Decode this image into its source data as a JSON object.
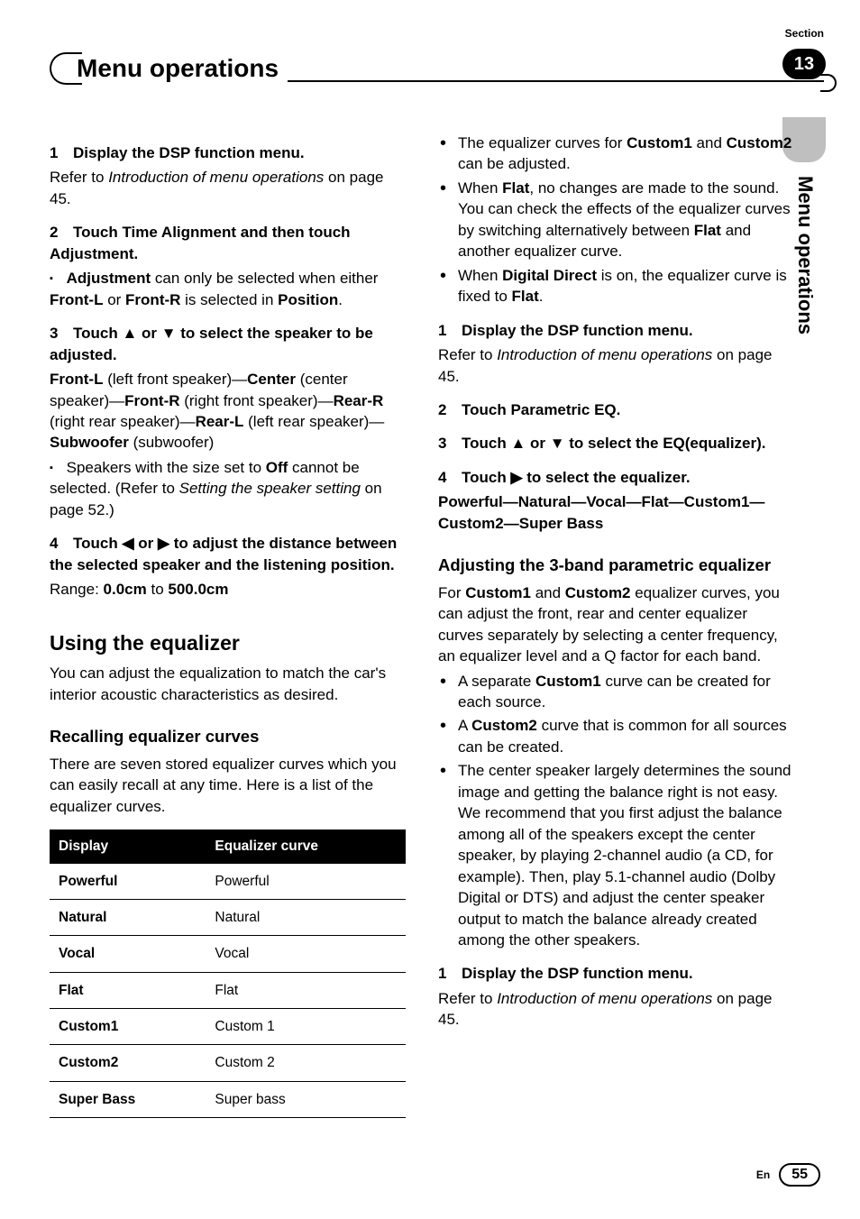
{
  "header": {
    "title": "Menu operations",
    "section_label": "Section",
    "section_number": "13",
    "side_label": "Menu operations"
  },
  "left": {
    "s1_num": "1",
    "s1_label": "Display the DSP function menu.",
    "s1_body_a": "Refer to ",
    "s1_body_i": "Introduction of menu operations",
    "s1_body_b": " on page 45.",
    "s2_num": "2",
    "s2_label": "Touch Time Alignment and then touch Adjustment.",
    "s2_note_a": "Adjustment",
    "s2_note_b": " can only be selected when either ",
    "s2_note_c": "Front-L",
    "s2_note_d": " or ",
    "s2_note_e": "Front-R",
    "s2_note_f": " is selected in ",
    "s2_note_g": "Position",
    "s2_note_h": ".",
    "s3_num": "3",
    "s3_label": "Touch ▲ or ▼ to select the speaker to be adjusted.",
    "s3_seq_a": "Front-L",
    "s3_seq_b": " (left front speaker)—",
    "s3_seq_c": "Center",
    "s3_seq_d": " (center speaker)—",
    "s3_seq_e": "Front-R",
    "s3_seq_f": " (right front speaker)—",
    "s3_seq_g": "Rear-R",
    "s3_seq_h": " (right rear speaker)—",
    "s3_seq_i": "Rear-L",
    "s3_seq_j": " (left rear speaker)—",
    "s3_seq_k": "Subwoofer",
    "s3_seq_l": " (subwoofer)",
    "s3_note_a": "Speakers with the size set to ",
    "s3_note_b": "Off",
    "s3_note_c": " cannot be selected. (Refer to ",
    "s3_note_i": "Setting the speaker setting",
    "s3_note_d": " on page 52.)",
    "s4_num": "4",
    "s4_label": "Touch ◀ or ▶ to adjust the distance between the selected speaker and the listening position.",
    "s4_range_a": "Range: ",
    "s4_range_b": "0.0cm",
    "s4_range_c": " to ",
    "s4_range_d": "500.0cm",
    "h2": "Using the equalizer",
    "h2_body": "You can adjust the equalization to match the car's interior acoustic characteristics as desired.",
    "h3": "Recalling equalizer curves",
    "h3_body": "There are seven stored equalizer curves which you can easily recall at any time. Here is a list of the equalizer curves.",
    "table": {
      "col1": "Display",
      "col2": "Equalizer curve",
      "rows": [
        [
          "Powerful",
          "Powerful"
        ],
        [
          "Natural",
          "Natural"
        ],
        [
          "Vocal",
          "Vocal"
        ],
        [
          "Flat",
          "Flat"
        ],
        [
          "Custom1",
          "Custom 1"
        ],
        [
          "Custom2",
          "Custom 2"
        ],
        [
          "Super Bass",
          "Super bass"
        ]
      ]
    }
  },
  "right": {
    "bul1_a": "The equalizer curves for ",
    "bul1_b": "Custom1",
    "bul1_c": " and ",
    "bul1_d": "Custom2",
    "bul1_e": " can be adjusted.",
    "bul2_a": "When ",
    "bul2_b": "Flat",
    "bul2_c": ", no changes are made to the sound. You can check the effects of the equalizer curves by switching alternatively between ",
    "bul2_d": "Flat",
    "bul2_e": " and another equalizer curve.",
    "bul3_a": "When ",
    "bul3_b": "Digital Direct",
    "bul3_c": " is on, the equalizer curve is fixed to ",
    "bul3_d": "Flat",
    "bul3_e": ".",
    "r1_num": "1",
    "r1_label": "Display the DSP function menu.",
    "r1_body_a": "Refer to ",
    "r1_body_i": "Introduction of menu operations",
    "r1_body_b": " on page 45.",
    "r2_num": "2",
    "r2_label": "Touch Parametric EQ.",
    "r3_num": "3",
    "r3_label": "Touch ▲ or ▼ to select the EQ(equalizer).",
    "r4_num": "4",
    "r4_label": "Touch ▶ to select the equalizer.",
    "r4_seq": "Powerful—Natural—Vocal—Flat—Custom1—Custom2—Super Bass",
    "h3b": "Adjusting the 3-band parametric equalizer",
    "h3b_body_a": "For ",
    "h3b_body_b": "Custom1",
    "h3b_body_c": " and ",
    "h3b_body_d": "Custom2",
    "h3b_body_e": " equalizer curves, you can adjust the front, rear and center equalizer curves separately by selecting a center frequency, an equalizer level and a Q factor for each band.",
    "bulb1_a": "A separate ",
    "bulb1_b": "Custom1",
    "bulb1_c": " curve can be created for each source.",
    "bulb2_a": "A ",
    "bulb2_b": "Custom2",
    "bulb2_c": " curve that is common for all sources can be created.",
    "bulb3": "The center speaker largely determines the sound image and getting the balance right is not easy. We recommend that you first adjust the balance among all of the speakers except the center speaker, by playing 2-channel audio (a CD, for example). Then, play 5.1-channel audio (Dolby Digital or DTS) and adjust the center speaker output to match the balance already created among the other speakers.",
    "rb1_num": "1",
    "rb1_label": "Display the DSP function menu.",
    "rb1_body_a": "Refer to ",
    "rb1_body_i": "Introduction of menu operations",
    "rb1_body_b": " on page 45."
  },
  "footer": {
    "lang": "En",
    "page": "55"
  }
}
